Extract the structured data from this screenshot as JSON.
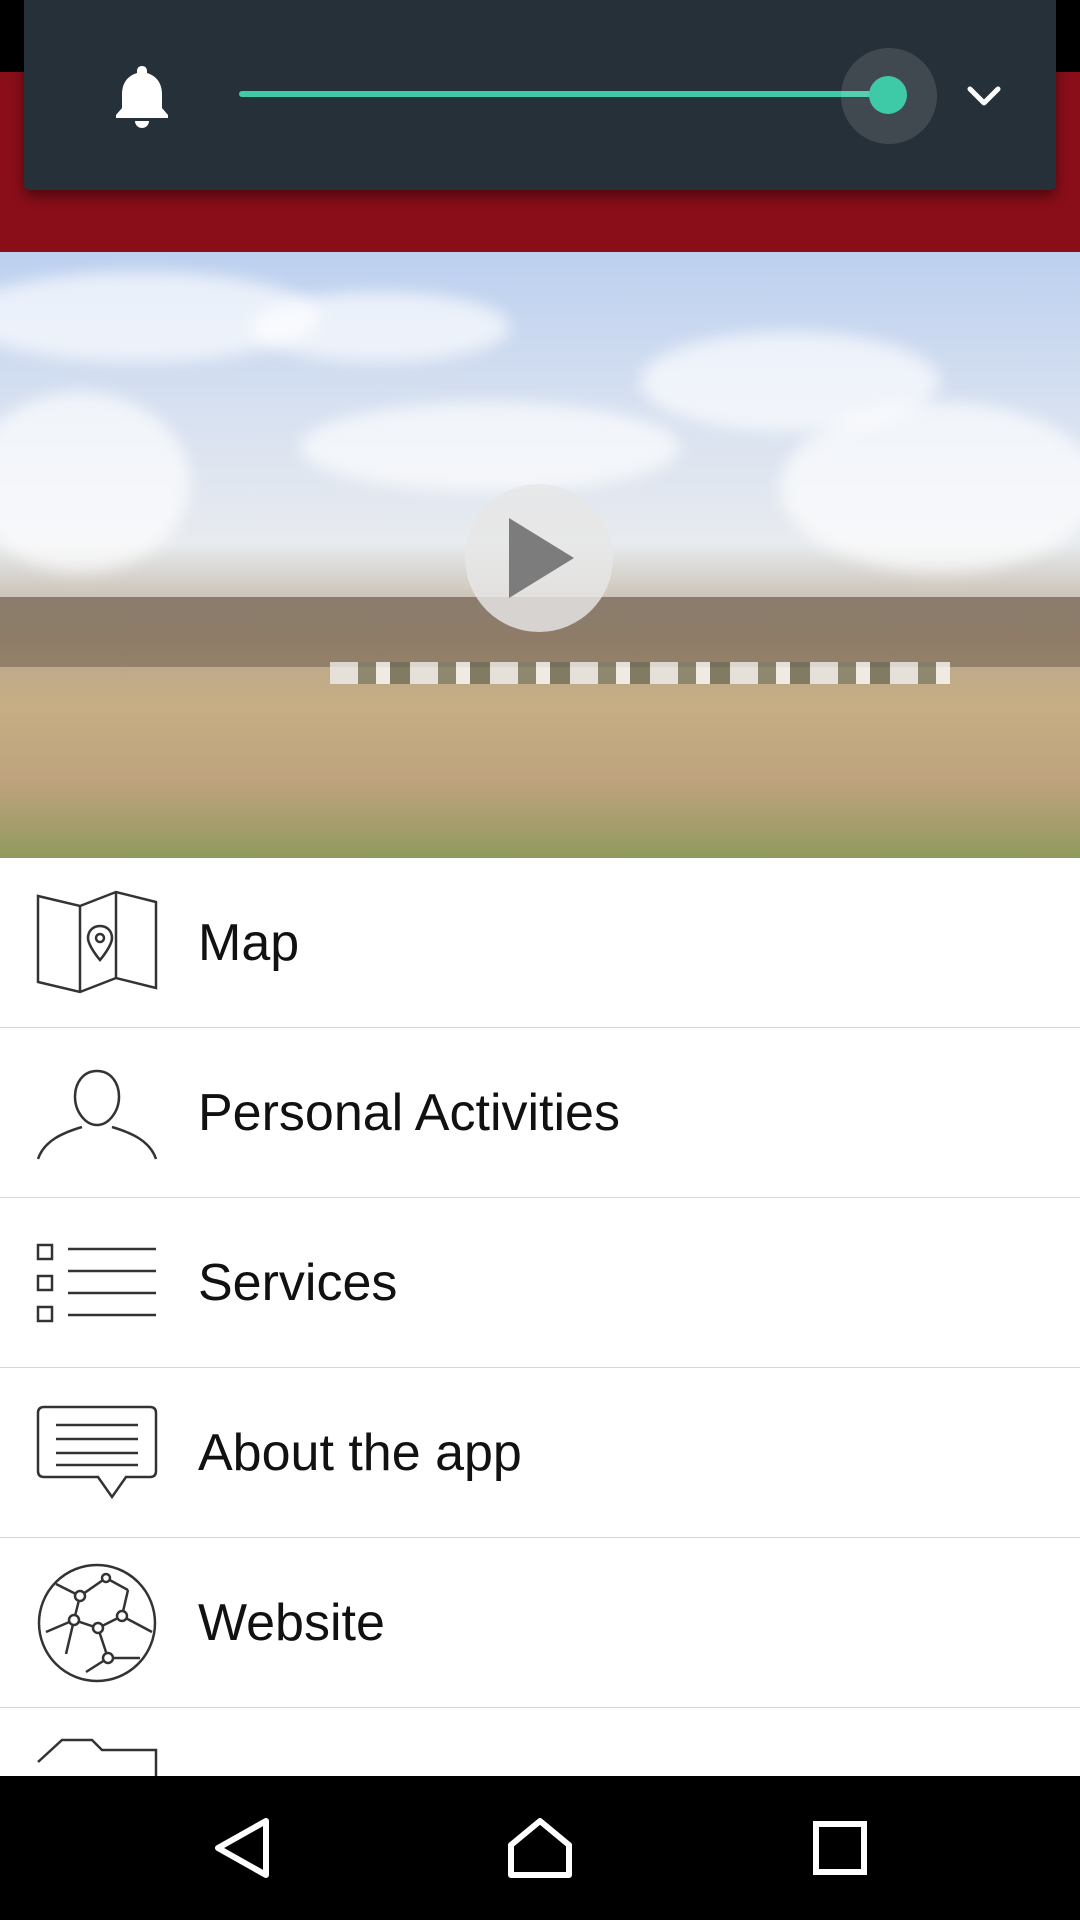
{
  "app": {
    "accent_color": "#8a0e19"
  },
  "volume_panel": {
    "icon": "bell-icon",
    "slider_level_percent": 100,
    "slider_color": "#3ec9a7",
    "collapse_icon": "chevron-down-icon"
  },
  "video": {
    "play_icon": "play-icon"
  },
  "menu": {
    "items": [
      {
        "label": "Map",
        "icon": "map-icon"
      },
      {
        "label": "Personal Activities",
        "icon": "person-icon"
      },
      {
        "label": "Services",
        "icon": "list-icon"
      },
      {
        "label": "About the app",
        "icon": "chat-icon"
      },
      {
        "label": "Website",
        "icon": "globe-icon"
      },
      {
        "label": "",
        "icon": "folder-icon"
      }
    ]
  },
  "nav_bar": {
    "back_icon": "back-icon",
    "home_icon": "home-icon",
    "recents_icon": "recents-icon"
  }
}
